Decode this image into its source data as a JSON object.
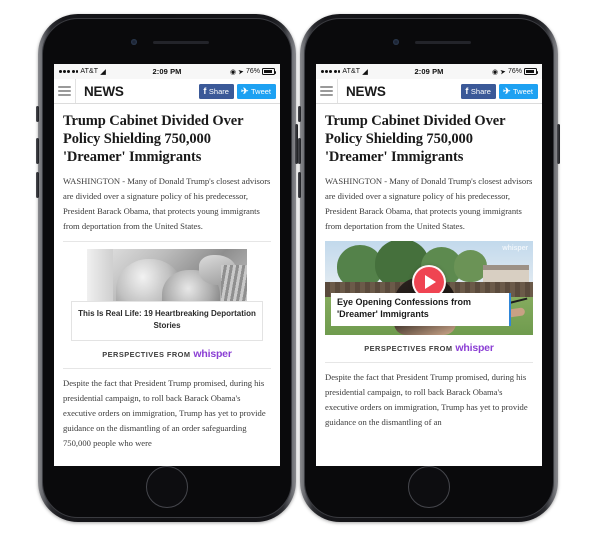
{
  "status_bar": {
    "carrier": "AT&T",
    "signal_dots": 5,
    "signal_filled": 4,
    "wifi_icon": "wifi-icon",
    "time": "2:09 PM",
    "alarm_icon": "location-services-icon",
    "location_icon": "location-arrow-icon",
    "battery_percent": "76%",
    "battery_icon": "battery-icon"
  },
  "navbar": {
    "menu_icon": "hamburger-menu-icon",
    "brand": "NEWS",
    "facebook": {
      "label": "Share",
      "glyph": "f",
      "color": "#3b5998",
      "icon": "facebook-icon"
    },
    "twitter": {
      "label": "Tweet",
      "glyph": "✐",
      "color": "#1da1f2",
      "icon": "twitter-icon"
    }
  },
  "article": {
    "headline": "Trump Cabinet Divided Over Policy Shielding 750,000 'Dreamer' Immigrants",
    "lede": "WASHINGTON - Many of Donald Trump's closest advisors are divided over a signature policy of his predecessor, President Barack Obama, that protects young immigrants from deportation from the United States.",
    "body_left": "Despite the fact that President Trump promised, during his presidential campaign, to roll back Barack Obama's executive orders on immigration, Trump has yet to provide guidance on the dismantling of an order safeguarding 750,000 people who were",
    "body_right": "Despite the fact that President Trump promised, during his presidential campaign, to roll back Barack Obama's executive orders on immigration, Trump has yet to provide guidance on the dismantling of an"
  },
  "ad_image_card": {
    "caption": "This Is Real Life: 19 Heartbreaking Deportation Stories",
    "photo_alt": "mother-and-child-photo"
  },
  "ad_video_card": {
    "caption": "Eye Opening Confessions from 'Dreamer' Immigrants",
    "watermark": "whisper",
    "play_icon": "play-button-icon",
    "play_color": "#ef4452",
    "accent_color": "#2f86d8"
  },
  "branding": {
    "prefix": "PERSPECTIVES FROM",
    "name": "whisper",
    "color": "#8b3fd4"
  }
}
